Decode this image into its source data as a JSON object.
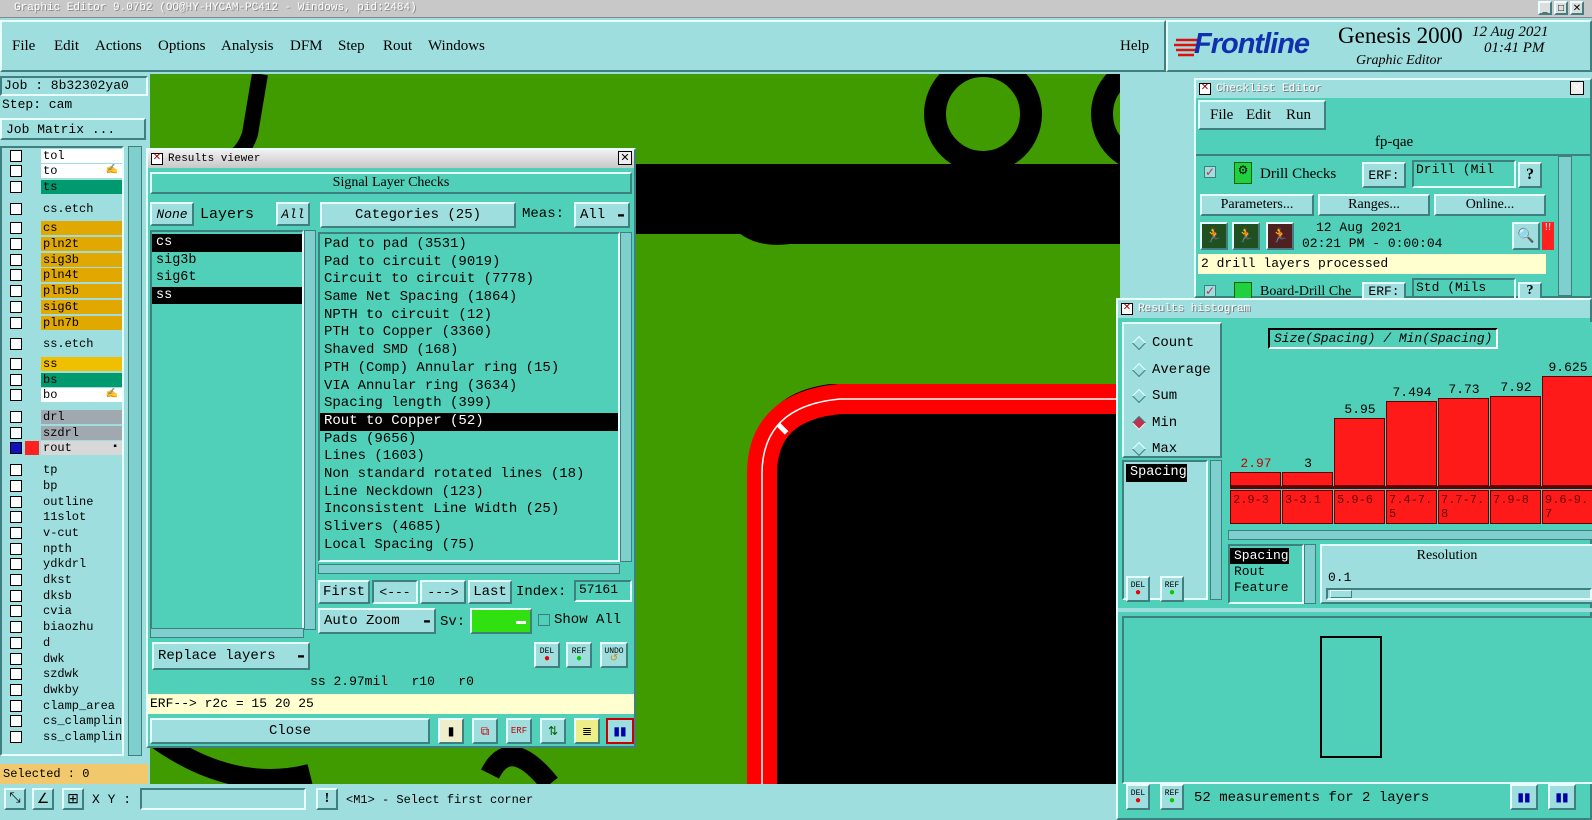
{
  "window": {
    "title": "Graphic Editor 9.07b2 (OO@HY-HYCAM-PC412 - Windows, pid:2484)"
  },
  "menu": {
    "items": [
      "File",
      "Edit",
      "Actions",
      "Options",
      "Analysis",
      "DFM",
      "Step",
      "Rout",
      "Windows"
    ],
    "help": "Help"
  },
  "brand": {
    "logo": "Frontline",
    "product": "Genesis 2000",
    "subtitle": "Graphic Editor",
    "date": "12 Aug 2021",
    "time": "01:41 PM"
  },
  "job": {
    "job_label": "Job : 8b32302ya0",
    "step_label": "Step: cam",
    "matrix_button": "Job Matrix ..."
  },
  "layers": [
    {
      "name": "tol",
      "color": "#ffffff",
      "icon": ""
    },
    {
      "name": "to",
      "color": "#ffffff",
      "icon": "✍"
    },
    {
      "name": "ts",
      "color": "#009a6e",
      "icon": ""
    },
    {
      "name": "cs.etch",
      "color": "#9edede",
      "icon": ""
    },
    {
      "name": "cs",
      "color": "#e0a800",
      "icon": ""
    },
    {
      "name": "pln2t",
      "color": "#e0a800",
      "icon": ""
    },
    {
      "name": "sig3b",
      "color": "#e0a800",
      "icon": ""
    },
    {
      "name": "pln4t",
      "color": "#e0a800",
      "icon": ""
    },
    {
      "name": "pln5b",
      "color": "#e0a800",
      "icon": ""
    },
    {
      "name": "sig6t",
      "color": "#e0a800",
      "icon": ""
    },
    {
      "name": "pln7b",
      "color": "#e0a800",
      "icon": ""
    },
    {
      "name": "ss.etch",
      "color": "#9edede",
      "icon": ""
    },
    {
      "name": "ss",
      "color": "#f0c000",
      "icon": ""
    },
    {
      "name": "bs",
      "color": "#009a6e",
      "icon": ""
    },
    {
      "name": "bo",
      "color": "#ffffff",
      "icon": "✍"
    },
    {
      "name": "drl",
      "color": "#a0a8b0",
      "icon": ""
    },
    {
      "name": "szdrl",
      "color": "#a0a8b0",
      "icon": ""
    },
    {
      "name": "rout",
      "color": "#d8d8d8",
      "icon": "▪"
    },
    {
      "name": "tp",
      "color": "#9edede",
      "icon": ""
    },
    {
      "name": "bp",
      "color": "#9edede",
      "icon": ""
    },
    {
      "name": "outline",
      "color": "#9edede",
      "icon": ""
    },
    {
      "name": "11slot",
      "color": "#9edede",
      "icon": ""
    },
    {
      "name": "v-cut",
      "color": "#9edede",
      "icon": ""
    },
    {
      "name": "npth",
      "color": "#9edede",
      "icon": ""
    },
    {
      "name": "ydkdrl",
      "color": "#9edede",
      "icon": ""
    },
    {
      "name": "dkst",
      "color": "#9edede",
      "icon": ""
    },
    {
      "name": "dksb",
      "color": "#9edede",
      "icon": ""
    },
    {
      "name": "cvia",
      "color": "#9edede",
      "icon": ""
    },
    {
      "name": "biaozhu",
      "color": "#9edede",
      "icon": ""
    },
    {
      "name": "d",
      "color": "#9edede",
      "icon": ""
    },
    {
      "name": "dwk",
      "color": "#9edede",
      "icon": ""
    },
    {
      "name": "szdwk",
      "color": "#9edede",
      "icon": ""
    },
    {
      "name": "dwkby",
      "color": "#9edede",
      "icon": ""
    },
    {
      "name": "clamp_area",
      "color": "#9edede",
      "icon": ""
    },
    {
      "name": "cs_clampline",
      "color": "#9edede",
      "icon": ""
    },
    {
      "name": "ss_clampline",
      "color": "#9edede",
      "icon": ""
    }
  ],
  "status": {
    "selected": "Selected : 0",
    "xy_label": "X Y :",
    "xy_value": "",
    "prompt": "<M1> - Select first corner"
  },
  "results_viewer": {
    "title": "Results viewer",
    "header": "Signal Layer Checks",
    "none_btn": "None",
    "layers_label": "Layers",
    "all_btn": "All",
    "categories_label": "Categories (25)",
    "meas_label": "Meas:",
    "meas_value": "All",
    "layers": [
      "cs",
      "sig3b",
      "sig6t",
      "ss"
    ],
    "selected_layers": [
      "cs",
      "ss"
    ],
    "categories": [
      "Pad to pad (3531)",
      "Pad to circuit (9019)",
      "Circuit to circuit (7778)",
      "Same Net Spacing (1864)",
      "NPTH to circuit (12)",
      "PTH to Copper (3360)",
      "Shaved SMD (168)",
      "PTH (Comp) Annular ring (15)",
      "VIA Annular ring (3634)",
      "Spacing length (399)",
      "Rout to Copper (52)",
      "Pads (9656)",
      "Lines (1603)",
      "Non standard rotated lines (18)",
      "Line Neckdown (123)",
      "Inconsistent Line Width (25)",
      "Slivers (4685)",
      "Local Spacing (75)"
    ],
    "selected_category": "Rout to Copper (52)",
    "first_btn": "First",
    "prev_btn": "<---",
    "next_btn": "--->",
    "last_btn": "Last",
    "index_label": "Index:",
    "index_value": "57161",
    "auto_zoom": "Auto Zoom",
    "sv_label": "Sv:",
    "show_all": "Show All",
    "replace_layers": "Replace layers",
    "del": "DEL",
    "ref": "REF",
    "undo": "UNDO",
    "info_line": "ss 2.97mil   r10   r0",
    "erf_line": "ERF--> r2c = 15 20 25",
    "close_btn": "Close"
  },
  "checklist": {
    "title": "Checklist Editor",
    "menu": [
      "File",
      "Edit",
      "Run"
    ],
    "name": "fp-qae",
    "drill_checks": "Drill Checks",
    "erf_label": "ERF:",
    "erf_value": "Drill (Mil",
    "help": "?",
    "parameters": "Parameters...",
    "ranges": "Ranges...",
    "online": "Online...",
    "run_date": "12 Aug 2021",
    "run_time": "02:21 PM - 0:00:04",
    "message": "2 drill layers processed",
    "board_drill": "Board-Drill Che",
    "erf_value2": "Std (Mils"
  },
  "histogram": {
    "title": "Results histogram",
    "modes": [
      "Count",
      "Average",
      "Sum",
      "Min",
      "Max"
    ],
    "selected_mode": "Min",
    "chart_title": "Size(Spacing) / Min(Spacing)",
    "left_list": [
      "Spacing"
    ],
    "attr_list": [
      "Spacing",
      "Rout",
      "Feature"
    ],
    "resolution_label": "Resolution",
    "resolution_value": "0.1",
    "del": "DEL",
    "ref": "REF",
    "summary": "52 measurements for 2 layers"
  },
  "chart_data": {
    "type": "bar",
    "title": "Size(Spacing) / Min(Spacing)",
    "categories": [
      "2.9-3",
      "3-3.1",
      "5.9-6",
      "7.4-7.5",
      "7.7-7.8",
      "7.9-8",
      "9.6-9.7"
    ],
    "values": [
      2.97,
      3,
      5.95,
      7.494,
      7.73,
      7.92,
      9.625
    ],
    "value_labels": [
      "2.97",
      "3",
      "5.95",
      "7.494",
      "7.73",
      "7.92",
      "9.625"
    ],
    "ylim": [
      0,
      10
    ],
    "colors": {
      "bar": "#ff1a1a",
      "first_label": "#cc0000"
    }
  },
  "colors": {
    "canvas": "#3f9b00",
    "copper": "#000000",
    "rout": "#ff0000",
    "panel": "#9edede",
    "dialog": "#50d0b8"
  }
}
